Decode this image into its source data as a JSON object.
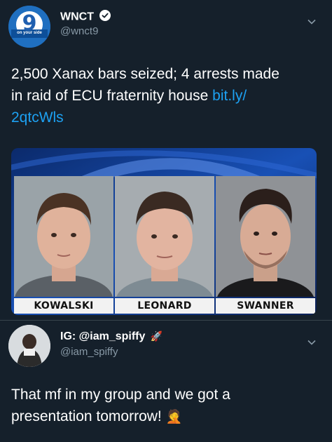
{
  "tweet1": {
    "display_name": "WNCT",
    "handle": "@wnct9",
    "avatar_text_large": "9",
    "avatar_text_small": "on your side",
    "text_before_link": "2,500 Xanax bars seized; 4 arrests made in raid of ECU fraternity house ",
    "link_text": "bit.ly/\n2qtcWls",
    "link_line1": "bit.ly/",
    "link_line2": "2qtcWls"
  },
  "media": {
    "names": [
      "KOWALSKI",
      "LEONARD",
      "SWANNER"
    ]
  },
  "tweet2": {
    "display_name": "IG: @iam_spiffy",
    "handle": "@iam_spiffy",
    "emoji_after_name": "🚀",
    "text_line1": "That mf in my group and we got a",
    "text_line2": "presentation tomorrow!",
    "emoji_end": "🤦"
  },
  "colors": {
    "background": "#15202b",
    "link": "#1da1f2",
    "secondary_text": "#8899a6"
  }
}
